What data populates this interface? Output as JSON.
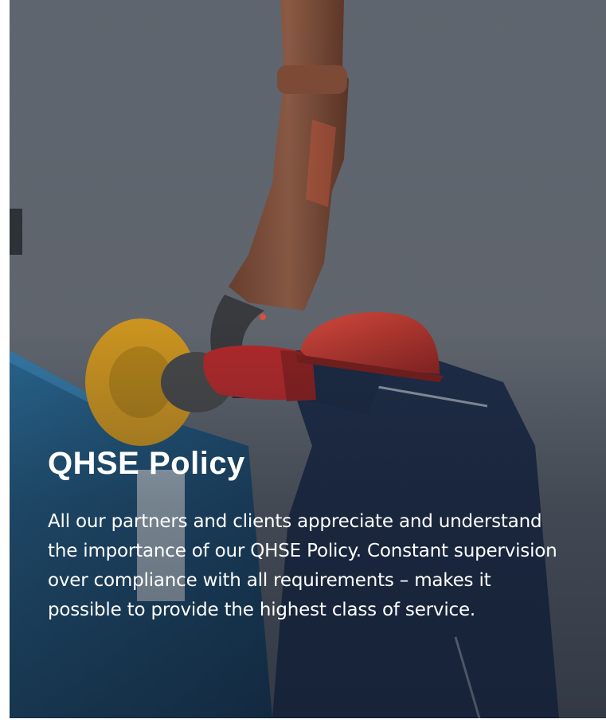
{
  "card": {
    "title": "QHSE Policy",
    "description": "All our partners and clients appreciate and understand the importance of our QHSE Policy. Constant supervision over compliance with all requirements – makes it possible to provide the highest class of service."
  },
  "colors": {
    "sky": "#5e646d",
    "container_blue": "#1d4f73",
    "shackle_yellow": "#d8a023",
    "helmet_red": "#c8302a",
    "glove_red": "#b5282a",
    "workwear_navy": "#1d2b45",
    "text": "#ffffff"
  }
}
